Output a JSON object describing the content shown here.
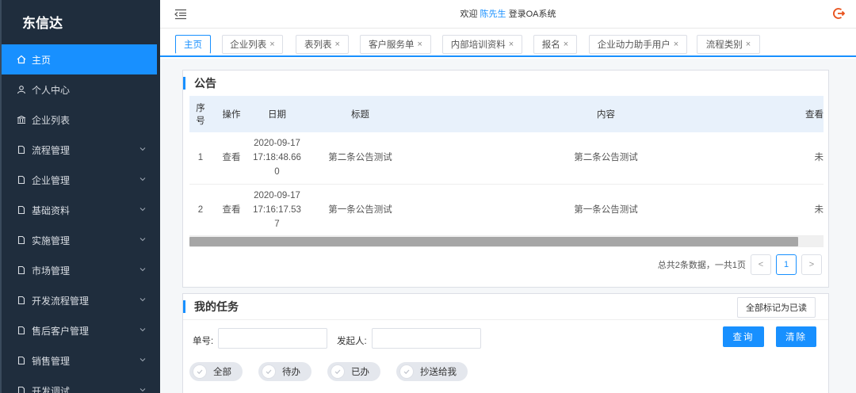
{
  "app": {
    "brand": "东信达"
  },
  "sidebar": {
    "items": [
      {
        "label": "主页",
        "icon": "home-icon",
        "active": true,
        "expandable": false
      },
      {
        "label": "个人中心",
        "icon": "user-icon",
        "expandable": false
      },
      {
        "label": "企业列表",
        "icon": "bank-icon",
        "expandable": false
      },
      {
        "label": "流程管理",
        "icon": "document-icon",
        "expandable": true
      },
      {
        "label": "企业管理",
        "icon": "document-icon",
        "expandable": true
      },
      {
        "label": "基础资料",
        "icon": "document-icon",
        "expandable": true
      },
      {
        "label": "实施管理",
        "icon": "document-icon",
        "expandable": true
      },
      {
        "label": "市场管理",
        "icon": "document-icon",
        "expandable": true
      },
      {
        "label": "开发流程管理",
        "icon": "document-icon",
        "expandable": true
      },
      {
        "label": "售后客户管理",
        "icon": "document-icon",
        "expandable": true
      },
      {
        "label": "销售管理",
        "icon": "document-icon",
        "expandable": true
      },
      {
        "label": "开发调试",
        "icon": "document-icon",
        "expandable": true
      }
    ]
  },
  "header": {
    "welcome_prefix": "欢迎",
    "user_name": "陈先生",
    "welcome_suffix": "登录OA系统"
  },
  "tabs": [
    {
      "label": "主页",
      "closable": false,
      "active": true
    },
    {
      "label": "企业列表",
      "closable": true
    },
    {
      "label": "表列表",
      "closable": true
    },
    {
      "label": "客户服务单",
      "closable": true
    },
    {
      "label": "内部培训资料",
      "closable": true
    },
    {
      "label": "报名",
      "closable": true
    },
    {
      "label": "企业动力助手用户",
      "closable": true
    },
    {
      "label": "流程类别",
      "closable": true
    }
  ],
  "notice": {
    "title": "公告",
    "columns": [
      "序号",
      "操作",
      "日期",
      "标题",
      "内容",
      "查看"
    ],
    "rows": [
      {
        "index": "1",
        "action": "查看",
        "date_l1": "2020-09-17",
        "date_l2": "17:18:48.66",
        "date_l3": "0",
        "title": "第二条公告测试",
        "content": "第二条公告测试",
        "status": "未"
      },
      {
        "index": "2",
        "action": "查看",
        "date_l1": "2020-09-17",
        "date_l2": "17:16:17.53",
        "date_l3": "7",
        "title": "第一条公告测试",
        "content": "第一条公告测试",
        "status": "未"
      }
    ],
    "pagination": {
      "summary": "总共2条数据，一共1页",
      "current_page": "1",
      "prev": "<",
      "next": ">"
    }
  },
  "tasks": {
    "title": "我的任务",
    "mark_all_read": "全部标记为已读",
    "fields": {
      "order_no_label": "单号:",
      "order_no_value": "",
      "initiator_label": "发起人:",
      "initiator_value": ""
    },
    "query_button": "查询",
    "clear_button": "清除",
    "filters": [
      "全部",
      "待办",
      "已办",
      "抄送给我"
    ]
  },
  "colors": {
    "sidebar_bg": "#1f2d3d",
    "accent": "#1890ff",
    "header_table_bg": "#e8f1fb",
    "logout": "#e8501a"
  }
}
